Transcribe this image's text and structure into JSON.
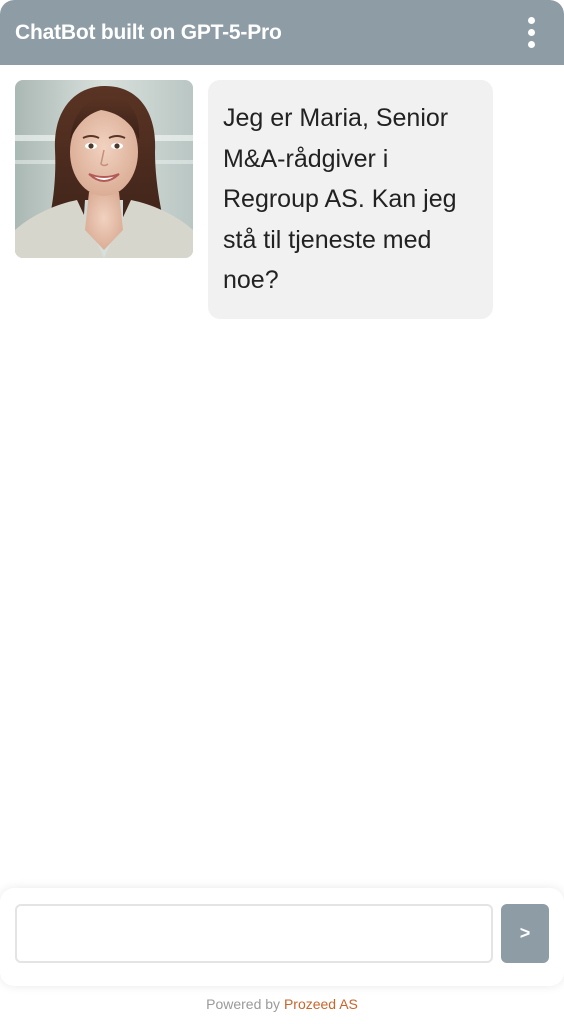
{
  "header": {
    "title": "ChatBot built on GPT-5-Pro",
    "menu_icon": "more-vertical-icon"
  },
  "conversation": {
    "messages": [
      {
        "sender": "Maria",
        "avatar": "woman-portrait-photo",
        "text": "Jeg er Maria, Senior M&A-rådgiver i Regroup AS. Kan jeg stå til tjeneste med noe?"
      }
    ]
  },
  "composer": {
    "input_value": "",
    "input_placeholder": "",
    "send_label": ">"
  },
  "footer": {
    "prefix": "Powered by ",
    "link_text": "Prozeed AS"
  },
  "colors": {
    "header_bg": "#8e9ca6",
    "bubble_bg": "#f1f1f1",
    "link": "#c8652b"
  }
}
